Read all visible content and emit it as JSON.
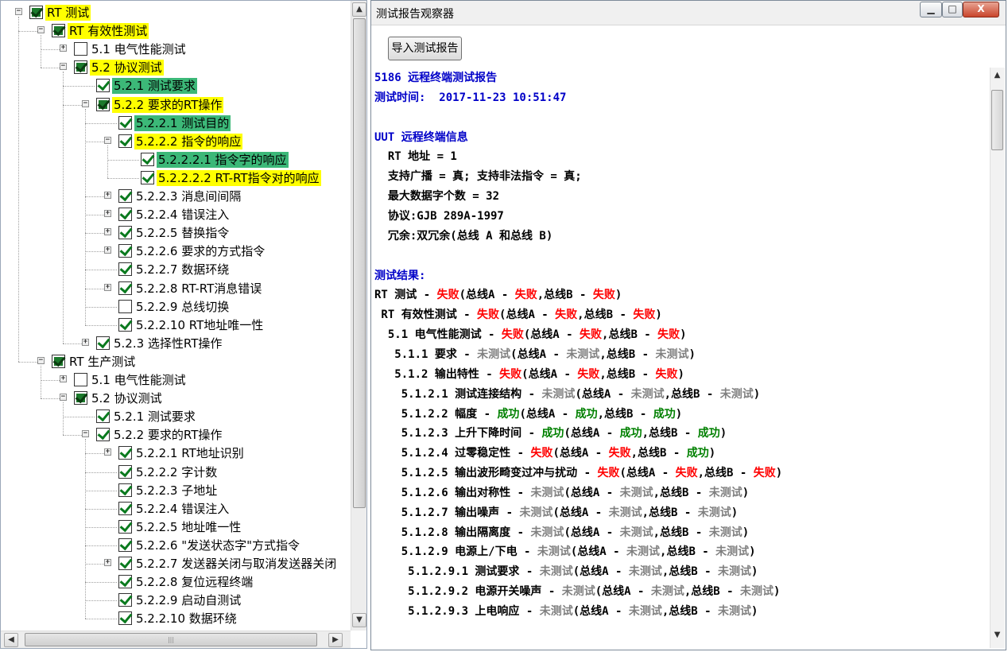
{
  "tree": {
    "rows": [
      {
        "label": "RT 测试",
        "indent": 0,
        "exp": "minus",
        "cb": "mixed",
        "hl": "yellow"
      },
      {
        "label": "RT 有效性测试",
        "indent": 1,
        "exp": "minus",
        "cb": "mixed",
        "hl": "yellow"
      },
      {
        "label": "5.1 电气性能测试",
        "indent": 2,
        "exp": "plus",
        "cb": "off",
        "hl": ""
      },
      {
        "label": "5.2 协议测试",
        "indent": 2,
        "exp": "minus",
        "cb": "mixed",
        "hl": "yellow"
      },
      {
        "label": "5.2.1 测试要求",
        "indent": 3,
        "exp": "",
        "cb": "on",
        "hl": "green"
      },
      {
        "label": "5.2.2 要求的RT操作",
        "indent": 3,
        "exp": "minus",
        "cb": "mixed",
        "hl": "yellow"
      },
      {
        "label": "5.2.2.1 测试目的",
        "indent": 4,
        "exp": "",
        "cb": "on",
        "hl": "green"
      },
      {
        "label": "5.2.2.2 指令的响应",
        "indent": 4,
        "exp": "minus",
        "cb": "on",
        "hl": "yellow"
      },
      {
        "label": "5.2.2.2.1 指令字的响应",
        "indent": 5,
        "exp": "",
        "cb": "on",
        "hl": "green"
      },
      {
        "label": "5.2.2.2.2 RT-RT指令对的响应",
        "indent": 5,
        "exp": "",
        "cb": "on",
        "hl": "yellow"
      },
      {
        "label": "5.2.2.3 消息间间隔",
        "indent": 4,
        "exp": "plus",
        "cb": "on",
        "hl": ""
      },
      {
        "label": "5.2.2.4 错误注入",
        "indent": 4,
        "exp": "plus",
        "cb": "on",
        "hl": ""
      },
      {
        "label": "5.2.2.5 替换指令",
        "indent": 4,
        "exp": "plus",
        "cb": "on",
        "hl": ""
      },
      {
        "label": "5.2.2.6 要求的方式指令",
        "indent": 4,
        "exp": "plus",
        "cb": "on",
        "hl": ""
      },
      {
        "label": "5.2.2.7 数据环绕",
        "indent": 4,
        "exp": "",
        "cb": "on",
        "hl": ""
      },
      {
        "label": "5.2.2.8 RT-RT消息错误",
        "indent": 4,
        "exp": "plus",
        "cb": "on",
        "hl": ""
      },
      {
        "label": "5.2.2.9 总线切换",
        "indent": 4,
        "exp": "",
        "cb": "off",
        "hl": ""
      },
      {
        "label": "5.2.2.10 RT地址唯一性",
        "indent": 4,
        "exp": "",
        "cb": "on",
        "hl": ""
      },
      {
        "label": "5.2.3 选择性RT操作",
        "indent": 3,
        "exp": "plus",
        "cb": "on",
        "hl": ""
      },
      {
        "label": "RT 生产测试",
        "indent": 1,
        "exp": "minus",
        "cb": "mixed",
        "hl": ""
      },
      {
        "label": "5.1 电气性能测试",
        "indent": 2,
        "exp": "plus",
        "cb": "off",
        "hl": ""
      },
      {
        "label": "5.2 协议测试",
        "indent": 2,
        "exp": "minus",
        "cb": "mixed",
        "hl": ""
      },
      {
        "label": "5.2.1 测试要求",
        "indent": 3,
        "exp": "",
        "cb": "on",
        "hl": ""
      },
      {
        "label": "5.2.2 要求的RT操作",
        "indent": 3,
        "exp": "minus",
        "cb": "on",
        "hl": ""
      },
      {
        "label": "5.2.2.1 RT地址识别",
        "indent": 4,
        "exp": "plus",
        "cb": "on",
        "hl": ""
      },
      {
        "label": "5.2.2.2 字计数",
        "indent": 4,
        "exp": "",
        "cb": "on",
        "hl": ""
      },
      {
        "label": "5.2.2.3 子地址",
        "indent": 4,
        "exp": "",
        "cb": "on",
        "hl": ""
      },
      {
        "label": "5.2.2.4 错误注入",
        "indent": 4,
        "exp": "",
        "cb": "on",
        "hl": ""
      },
      {
        "label": "5.2.2.5 地址唯一性",
        "indent": 4,
        "exp": "",
        "cb": "on",
        "hl": ""
      },
      {
        "label": "5.2.2.6 \"发送状态字\"方式指令",
        "indent": 4,
        "exp": "",
        "cb": "on",
        "hl": ""
      },
      {
        "label": "5.2.2.7 发送器关闭与取消发送器关闭",
        "indent": 4,
        "exp": "plus",
        "cb": "on",
        "hl": ""
      },
      {
        "label": "5.2.2.8 复位远程终端",
        "indent": 4,
        "exp": "",
        "cb": "on",
        "hl": ""
      },
      {
        "label": "5.2.2.9 启动自测试",
        "indent": 4,
        "exp": "",
        "cb": "on",
        "hl": ""
      },
      {
        "label": "5.2.2.10 数据环绕",
        "indent": 4,
        "exp": "",
        "cb": "on",
        "hl": ""
      }
    ]
  },
  "window": {
    "title": "测试报告观察器",
    "minimize": "▁",
    "maximize": "□",
    "close": "X",
    "import_button": "导入测试报告"
  },
  "report": {
    "lines": [
      [
        {
          "t": "5186 远程终端测试报告",
          "c": "blue"
        }
      ],
      [
        {
          "t": "测试时间:  2017-11-23 10:51:47",
          "c": "blue"
        }
      ],
      [],
      [
        {
          "t": "UUT 远程终端信息",
          "c": "blue"
        }
      ],
      [
        {
          "t": "  RT 地址 = 1",
          "c": ""
        }
      ],
      [
        {
          "t": "  支持广播 = 真; 支持非法指令 = 真;",
          "c": ""
        }
      ],
      [
        {
          "t": "  最大数据字个数 = 32",
          "c": ""
        }
      ],
      [
        {
          "t": "  协议:GJB 289A-1997",
          "c": ""
        }
      ],
      [
        {
          "t": "  冗余:双冗余(总线 A 和总线 B)",
          "c": ""
        }
      ],
      [],
      [
        {
          "t": "测试结果:",
          "c": "blue"
        }
      ],
      [
        {
          "t": "RT 测试 - ",
          "c": ""
        },
        {
          "t": "失败",
          "c": "red"
        },
        {
          "t": "(总线A - ",
          "c": ""
        },
        {
          "t": "失败",
          "c": "red"
        },
        {
          "t": ",总线B - ",
          "c": ""
        },
        {
          "t": "失败",
          "c": "red"
        },
        {
          "t": ")",
          "c": ""
        }
      ],
      [
        {
          "t": " RT 有效性测试 - ",
          "c": ""
        },
        {
          "t": "失败",
          "c": "red"
        },
        {
          "t": "(总线A - ",
          "c": ""
        },
        {
          "t": "失败",
          "c": "red"
        },
        {
          "t": ",总线B - ",
          "c": ""
        },
        {
          "t": "失败",
          "c": "red"
        },
        {
          "t": ")",
          "c": ""
        }
      ],
      [
        {
          "t": "  5.1 电气性能测试 - ",
          "c": ""
        },
        {
          "t": "失败",
          "c": "red"
        },
        {
          "t": "(总线A - ",
          "c": ""
        },
        {
          "t": "失败",
          "c": "red"
        },
        {
          "t": ",总线B - ",
          "c": ""
        },
        {
          "t": "失败",
          "c": "red"
        },
        {
          "t": ")",
          "c": ""
        }
      ],
      [
        {
          "t": "   5.1.1 要求 - ",
          "c": ""
        },
        {
          "t": "未测试",
          "c": "gray"
        },
        {
          "t": "(总线A - ",
          "c": ""
        },
        {
          "t": "未测试",
          "c": "gray"
        },
        {
          "t": ",总线B - ",
          "c": ""
        },
        {
          "t": "未测试",
          "c": "gray"
        },
        {
          "t": ")",
          "c": ""
        }
      ],
      [
        {
          "t": "   5.1.2 输出特性 - ",
          "c": ""
        },
        {
          "t": "失败",
          "c": "red"
        },
        {
          "t": "(总线A - ",
          "c": ""
        },
        {
          "t": "失败",
          "c": "red"
        },
        {
          "t": ",总线B - ",
          "c": ""
        },
        {
          "t": "失败",
          "c": "red"
        },
        {
          "t": ")",
          "c": ""
        }
      ],
      [
        {
          "t": "    5.1.2.1 测试连接结构 - ",
          "c": ""
        },
        {
          "t": "未测试",
          "c": "gray"
        },
        {
          "t": "(总线A - ",
          "c": ""
        },
        {
          "t": "未测试",
          "c": "gray"
        },
        {
          "t": ",总线B - ",
          "c": ""
        },
        {
          "t": "未测试",
          "c": "gray"
        },
        {
          "t": ")",
          "c": ""
        }
      ],
      [
        {
          "t": "    5.1.2.2 幅度 - ",
          "c": ""
        },
        {
          "t": "成功",
          "c": "green"
        },
        {
          "t": "(总线A - ",
          "c": ""
        },
        {
          "t": "成功",
          "c": "green"
        },
        {
          "t": ",总线B - ",
          "c": ""
        },
        {
          "t": "成功",
          "c": "green"
        },
        {
          "t": ")",
          "c": ""
        }
      ],
      [
        {
          "t": "    5.1.2.3 上升下降时间 - ",
          "c": ""
        },
        {
          "t": "成功",
          "c": "green"
        },
        {
          "t": "(总线A - ",
          "c": ""
        },
        {
          "t": "成功",
          "c": "green"
        },
        {
          "t": ",总线B - ",
          "c": ""
        },
        {
          "t": "成功",
          "c": "green"
        },
        {
          "t": ")",
          "c": ""
        }
      ],
      [
        {
          "t": "    5.1.2.4 过零稳定性 - ",
          "c": ""
        },
        {
          "t": "失败",
          "c": "red"
        },
        {
          "t": "(总线A - ",
          "c": ""
        },
        {
          "t": "失败",
          "c": "red"
        },
        {
          "t": ",总线B - ",
          "c": ""
        },
        {
          "t": "成功",
          "c": "green"
        },
        {
          "t": ")",
          "c": ""
        }
      ],
      [
        {
          "t": "    5.1.2.5 输出波形畸变过冲与扰动 - ",
          "c": ""
        },
        {
          "t": "失败",
          "c": "red"
        },
        {
          "t": "(总线A - ",
          "c": ""
        },
        {
          "t": "失败",
          "c": "red"
        },
        {
          "t": ",总线B - ",
          "c": ""
        },
        {
          "t": "失败",
          "c": "red"
        },
        {
          "t": ")",
          "c": ""
        }
      ],
      [
        {
          "t": "    5.1.2.6 输出对称性 - ",
          "c": ""
        },
        {
          "t": "未测试",
          "c": "gray"
        },
        {
          "t": "(总线A - ",
          "c": ""
        },
        {
          "t": "未测试",
          "c": "gray"
        },
        {
          "t": ",总线B - ",
          "c": ""
        },
        {
          "t": "未测试",
          "c": "gray"
        },
        {
          "t": ")",
          "c": ""
        }
      ],
      [
        {
          "t": "    5.1.2.7 输出噪声 - ",
          "c": ""
        },
        {
          "t": "未测试",
          "c": "gray"
        },
        {
          "t": "(总线A - ",
          "c": ""
        },
        {
          "t": "未测试",
          "c": "gray"
        },
        {
          "t": ",总线B - ",
          "c": ""
        },
        {
          "t": "未测试",
          "c": "gray"
        },
        {
          "t": ")",
          "c": ""
        }
      ],
      [
        {
          "t": "    5.1.2.8 输出隔离度 - ",
          "c": ""
        },
        {
          "t": "未测试",
          "c": "gray"
        },
        {
          "t": "(总线A - ",
          "c": ""
        },
        {
          "t": "未测试",
          "c": "gray"
        },
        {
          "t": ",总线B - ",
          "c": ""
        },
        {
          "t": "未测试",
          "c": "gray"
        },
        {
          "t": ")",
          "c": ""
        }
      ],
      [
        {
          "t": "    5.1.2.9 电源上/下电 - ",
          "c": ""
        },
        {
          "t": "未测试",
          "c": "gray"
        },
        {
          "t": "(总线A - ",
          "c": ""
        },
        {
          "t": "未测试",
          "c": "gray"
        },
        {
          "t": ",总线B - ",
          "c": ""
        },
        {
          "t": "未测试",
          "c": "gray"
        },
        {
          "t": ")",
          "c": ""
        }
      ],
      [
        {
          "t": "     5.1.2.9.1 测试要求 - ",
          "c": ""
        },
        {
          "t": "未测试",
          "c": "gray"
        },
        {
          "t": "(总线A - ",
          "c": ""
        },
        {
          "t": "未测试",
          "c": "gray"
        },
        {
          "t": ",总线B - ",
          "c": ""
        },
        {
          "t": "未测试",
          "c": "gray"
        },
        {
          "t": ")",
          "c": ""
        }
      ],
      [
        {
          "t": "     5.1.2.9.2 电源开关噪声 - ",
          "c": ""
        },
        {
          "t": "未测试",
          "c": "gray"
        },
        {
          "t": "(总线A - ",
          "c": ""
        },
        {
          "t": "未测试",
          "c": "gray"
        },
        {
          "t": ",总线B - ",
          "c": ""
        },
        {
          "t": "未测试",
          "c": "gray"
        },
        {
          "t": ")",
          "c": ""
        }
      ],
      [
        {
          "t": "     5.1.2.9.3 上电响应 - ",
          "c": ""
        },
        {
          "t": "未测试",
          "c": "gray"
        },
        {
          "t": "(总线A - ",
          "c": ""
        },
        {
          "t": "未测试",
          "c": "gray"
        },
        {
          "t": ",总线B - ",
          "c": ""
        },
        {
          "t": "未测试",
          "c": "gray"
        },
        {
          "t": ")",
          "c": ""
        }
      ]
    ]
  },
  "scroll": {
    "up_arrow": "▲",
    "down_arrow": "▼",
    "left_arrow": "◀",
    "right_arrow": "▶",
    "grip": "|||"
  }
}
